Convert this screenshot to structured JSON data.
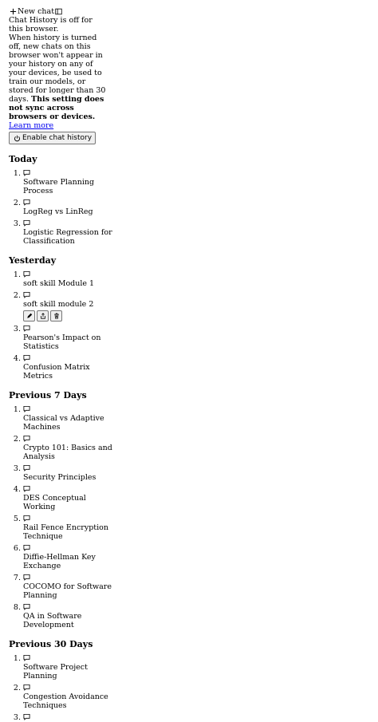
{
  "new_chat_label": "New chat",
  "history_notice": {
    "text": "Chat History is off for this browser.",
    "detail": "When history is turned off, new chats on this browser won't appear in your history on any of your devices, be used to train our models, or stored for longer than 30 days.",
    "bold": "This setting does not sync across browsers or devices.",
    "link": "Learn more",
    "button": "Enable chat history"
  },
  "sections": {
    "today": {
      "heading": "Today",
      "items": [
        "Software Planning Process",
        "LogReg vs LinReg",
        "Logistic Regression for Classification"
      ]
    },
    "yesterday": {
      "heading": "Yesterday",
      "items": [
        "soft skill Module 1",
        "soft skill module 2",
        "Pearson's Impact on Statistics",
        "Confusion Matrix Metrics"
      ]
    },
    "previous7": {
      "heading": "Previous 7 Days",
      "items": [
        "Classical vs Adaptive Machines",
        "Crypto 101: Basics and Analysis",
        "Security Principles",
        "DES Conceptual Working",
        "Rail Fence Encryption Technique",
        "Diffie-Hellman Key Exchange",
        "COCOMO for Software Planning",
        "QA in Software Development"
      ]
    },
    "previous30": {
      "heading": "Previous 30 Days",
      "items": [
        "Software Project Planning",
        "Congestion Avoidance Techniques",
        ""
      ]
    }
  },
  "icons": {
    "plus": "plus-icon",
    "sidebar": "sidebar-toggle-icon",
    "power": "power-icon",
    "chat": "chat-bubble-icon",
    "edit": "pencil-icon",
    "share": "share-icon",
    "delete": "trash-icon"
  }
}
